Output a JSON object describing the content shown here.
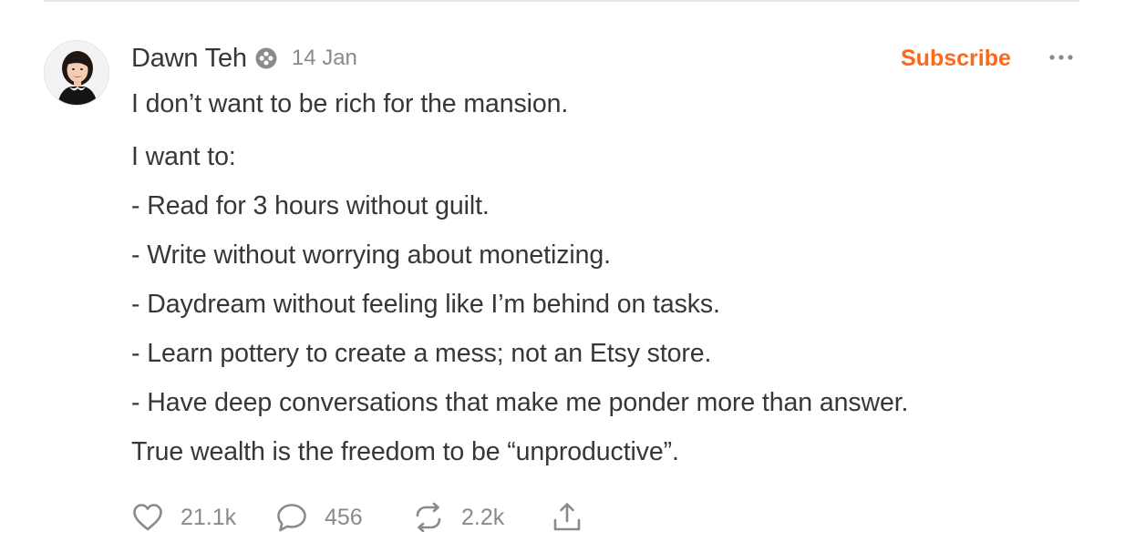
{
  "post": {
    "author": {
      "name": "Dawn Teh",
      "avatar_icon": "avatar-photo",
      "badge_icon": "verified-badge-icon"
    },
    "date": "14 Jan",
    "subscribe_label": "Subscribe",
    "more_icon": "more-horizontal-icon",
    "paragraphs": [
      "I don’t want to be rich for the mansion.",
      "I want to:",
      "- Read for 3 hours without guilt.",
      "- Write without worrying about monetizing.",
      "- Daydream without feeling like I’m behind on tasks.",
      "- Learn pottery to create a mess; not an Etsy store.",
      "- Have deep conversations that make me ponder more than answer.",
      "True wealth is the freedom to be “unproductive”."
    ],
    "actions": {
      "likes": "21.1k",
      "comments": "456",
      "restacks": "2.2k"
    }
  },
  "colors": {
    "accent": "#ff6719",
    "text": "#363737",
    "muted": "#8a8a8a",
    "divider": "#e6e6e6"
  }
}
